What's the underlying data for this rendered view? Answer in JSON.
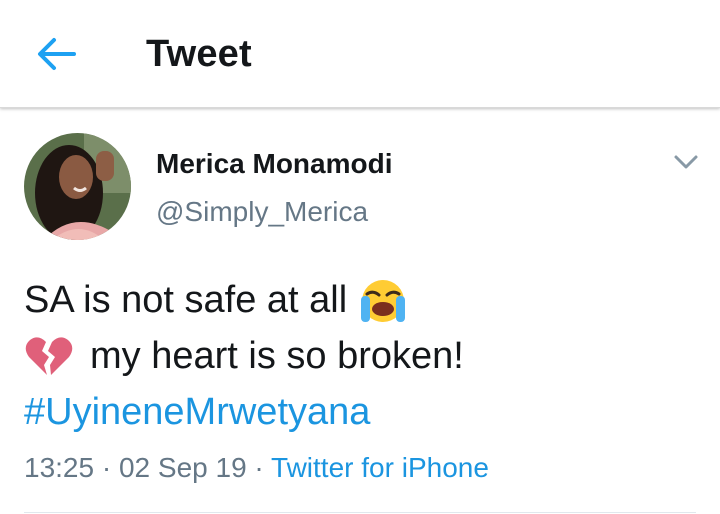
{
  "header": {
    "title": "Tweet",
    "back_icon": "arrow-left-icon"
  },
  "tweet": {
    "author_name": "Merica Monamodi",
    "author_handle": "@Simply_Merica",
    "line1": "SA is not safe at all",
    "line1_emoji": "loudly-crying-face-icon",
    "line2_emoji": "broken-heart-icon",
    "line2": "my heart is so broken!",
    "hashtag": "#UyineneMrwetyana",
    "time": "13:25",
    "separator": " · ",
    "date": "02 Sep 19",
    "source": "Twitter for iPhone",
    "menu_icon": "chevron-down-icon"
  },
  "colors": {
    "accent": "#1b95e0",
    "text": "#14171a",
    "muted": "#657786"
  }
}
